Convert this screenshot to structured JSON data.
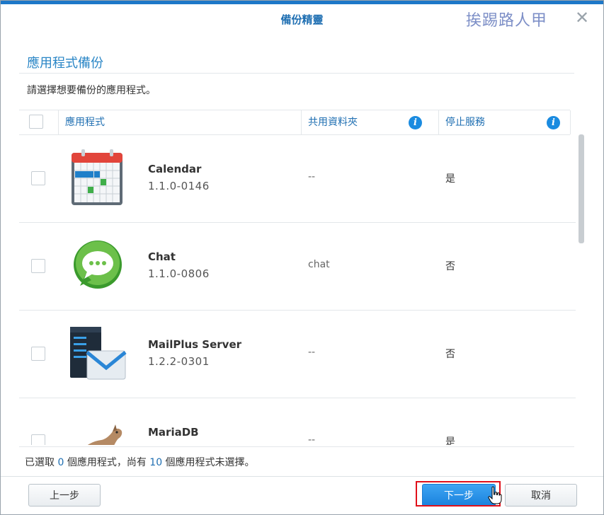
{
  "dialog": {
    "title": "備份精靈",
    "watermark": "挨踢路人甲",
    "section_title": "應用程式備份",
    "description": "請選擇想要備份的應用程式。"
  },
  "table": {
    "headers": {
      "app": "應用程式",
      "shared_folder": "共用資料夾",
      "stop_service": "停止服務",
      "info_glyph": "i"
    },
    "rows": [
      {
        "name": "Calendar",
        "version": "1.1.0-0146",
        "shared_folder": "--",
        "stop_service": "是",
        "icon": "calendar-icon"
      },
      {
        "name": "Chat",
        "version": "1.1.0-0806",
        "shared_folder": "chat",
        "stop_service": "否",
        "icon": "chat-icon"
      },
      {
        "name": "MailPlus Server",
        "version": "1.2.2-0301",
        "shared_folder": "--",
        "stop_service": "否",
        "icon": "mail-server-icon"
      },
      {
        "name": "MariaDB",
        "version": "",
        "shared_folder": "--",
        "stop_service": "是",
        "icon": "mariadb-seal-icon"
      }
    ]
  },
  "status": {
    "prefix": "已選取 ",
    "selected": "0",
    "middle": " 個應用程式，尚有 ",
    "unselected": "10",
    "suffix": " 個應用程式未選擇。"
  },
  "buttons": {
    "prev": "上一步",
    "next": "下一步",
    "cancel": "取消"
  },
  "colors": {
    "accent": "#1f6fb2",
    "primary_button": "#1a82dd",
    "highlight_box": "#e0101a"
  }
}
